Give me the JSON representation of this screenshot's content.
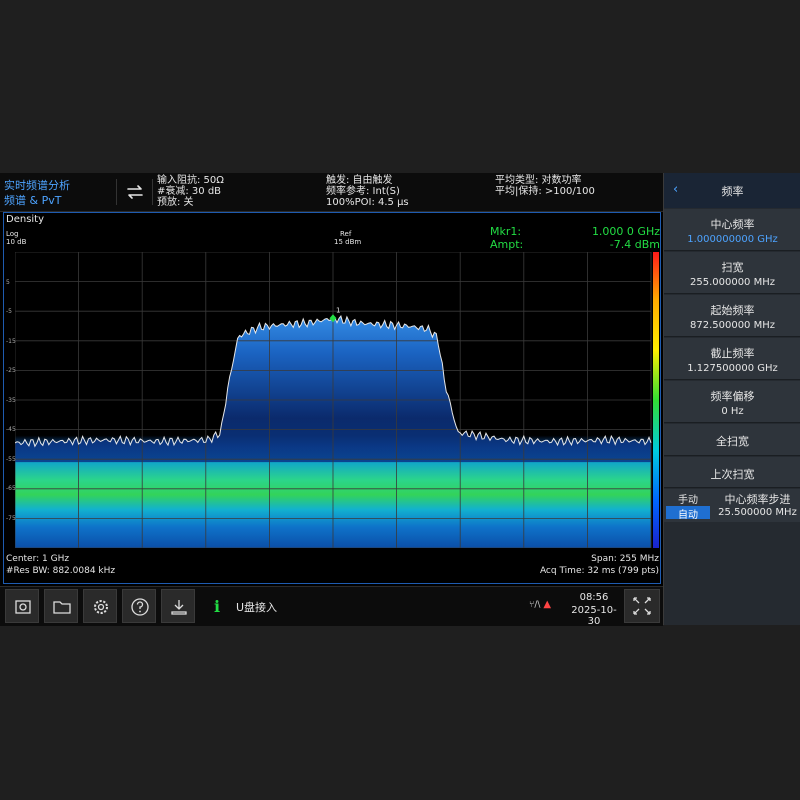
{
  "header": {
    "mode_line1": "实时频谱分析",
    "mode_line2": "频谱 & PvT",
    "impedance": "输入阻抗: 50Ω",
    "attenuation": "#衰减: 30 dB",
    "preamp": "预放: 关",
    "trigger": "触发: 自由触发",
    "freq_ref": "频率参考: Int(S)",
    "poi": "100%POI: 4.5 μs",
    "avg_type": "平均类型: 对数功率",
    "avg_hold": "平均|保持: >100/100"
  },
  "display": {
    "title": "Density",
    "scale_type": "Log",
    "scale_div": "10 dB",
    "ref_label": "Ref",
    "ref_value": "15 dBm",
    "marker_label": "Mkr1:",
    "marker_value": "1.000 0 GHz",
    "ampt_label": "Ampt:",
    "ampt_value": "-7.4 dBm",
    "marker_number": "1",
    "center": "Center: 1 GHz",
    "res_bw": "#Res BW: 882.0084 kHz",
    "span": "Span: 255 MHz",
    "acq_time": "Acq Time: 32 ms (799 pts)",
    "y_ticks": [
      "5",
      "-5",
      "-15",
      "-25",
      "-35",
      "-45",
      "-55",
      "-65",
      "-75"
    ]
  },
  "chart_data": {
    "type": "line",
    "xlabel": "",
    "ylabel": "",
    "x_unit": "MHz",
    "y_unit": "dBm",
    "xlim": [
      872.5,
      1127.5
    ],
    "ylim": [
      -85,
      15
    ],
    "grid": true,
    "x": [
      872.5,
      890,
      910,
      930,
      950,
      955,
      958,
      962,
      970,
      980,
      990,
      1000,
      1010,
      1020,
      1030,
      1038,
      1042,
      1045,
      1050,
      1070,
      1090,
      1110,
      1127.5
    ],
    "y": [
      -49.5,
      -49,
      -48.5,
      -49,
      -48.5,
      -46,
      -30,
      -13.5,
      -10.5,
      -9.5,
      -9,
      -7.4,
      -9,
      -9.5,
      -10,
      -11,
      -14,
      -30,
      -46,
      -48.5,
      -49,
      -48.5,
      -49
    ],
    "marker": {
      "x": 1000,
      "y": -7.4,
      "label": "1"
    },
    "colorbar_colors": [
      "#ff1a1a",
      "#ffaa00",
      "#ffee00",
      "#33dd33",
      "#00ccdd",
      "#0066ff",
      "#1a22cc"
    ]
  },
  "toolbar": {
    "buttons": [
      "screenshot-icon",
      "folder-icon",
      "gear-icon",
      "help-icon",
      "download-icon"
    ],
    "info_glyph": "i",
    "message": "U盘接入",
    "status_glyph": "⑂/\\",
    "warning_glyph": "▲",
    "time": "08:56",
    "date": "2025-10-30"
  },
  "menu": {
    "back_glyph": "‹",
    "title": "频率",
    "items": [
      {
        "label": "中心频率",
        "value": "1.000000000 GHz"
      },
      {
        "label": "扫宽",
        "value": "255.000000 MHz"
      },
      {
        "label": "起始频率",
        "value": "872.500000 MHz"
      },
      {
        "label": "截止频率",
        "value": "1.127500000 GHz"
      },
      {
        "label": "频率偏移",
        "value": "0 Hz"
      },
      {
        "label": "全扫宽",
        "value": ""
      },
      {
        "label": "上次扫宽",
        "value": ""
      }
    ],
    "step": {
      "manual": "手动",
      "auto": "自动",
      "label": "中心频率步进",
      "value": "25.500000 MHz"
    }
  }
}
